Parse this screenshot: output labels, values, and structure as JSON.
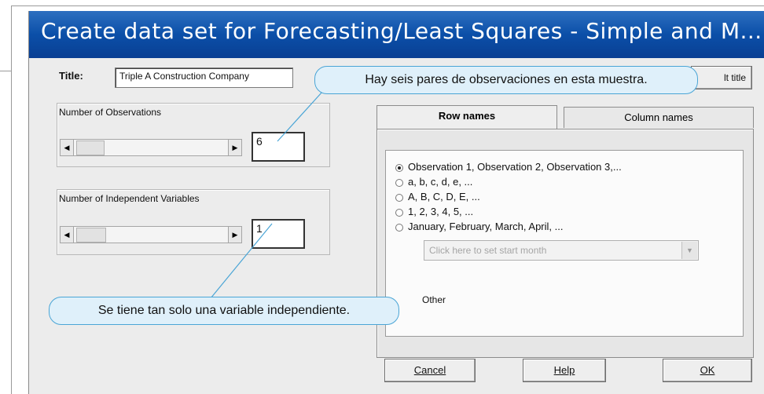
{
  "window": {
    "title": "Create data set for Forecasting/Least Squares - Simple and M..."
  },
  "title_row": {
    "label": "Title:",
    "value": "Triple A Construction Company",
    "edit_title_button": "lt title"
  },
  "observations": {
    "label": "Number of Observations",
    "value": "6",
    "scroll_left_glyph": "◀",
    "scroll_right_glyph": "▶"
  },
  "independent_variables": {
    "label": "Number of Independent Variables",
    "value": "1",
    "scroll_left_glyph": "◀",
    "scroll_right_glyph": "▶"
  },
  "tabs": [
    {
      "label": "Row names",
      "active": true
    },
    {
      "label": "Column names",
      "active": false
    }
  ],
  "row_name_options": [
    {
      "label": "Observation 1, Observation 2, Observation 3,...",
      "selected": true
    },
    {
      "label": "a, b, c, d, e, ...",
      "selected": false
    },
    {
      "label": "A, B, C, D, E, ...",
      "selected": false
    },
    {
      "label": "1, 2, 3, 4, 5, ...",
      "selected": false
    },
    {
      "label": "January, February, March, April, ...",
      "selected": false
    }
  ],
  "start_month": {
    "placeholder": "Click here to set start month",
    "arrow_glyph": "▼"
  },
  "other_label": "Other",
  "buttons": {
    "cancel": "Cancel",
    "help": "Help",
    "ok": "OK"
  },
  "callouts": {
    "observations": "Hay seis pares de observaciones en esta muestra.",
    "variables": "Se tiene tan solo una variable independiente."
  },
  "colors": {
    "titlebar": "#0b4fa8",
    "callout_fill": "#dff0fa",
    "callout_border": "#4aa5d6"
  }
}
